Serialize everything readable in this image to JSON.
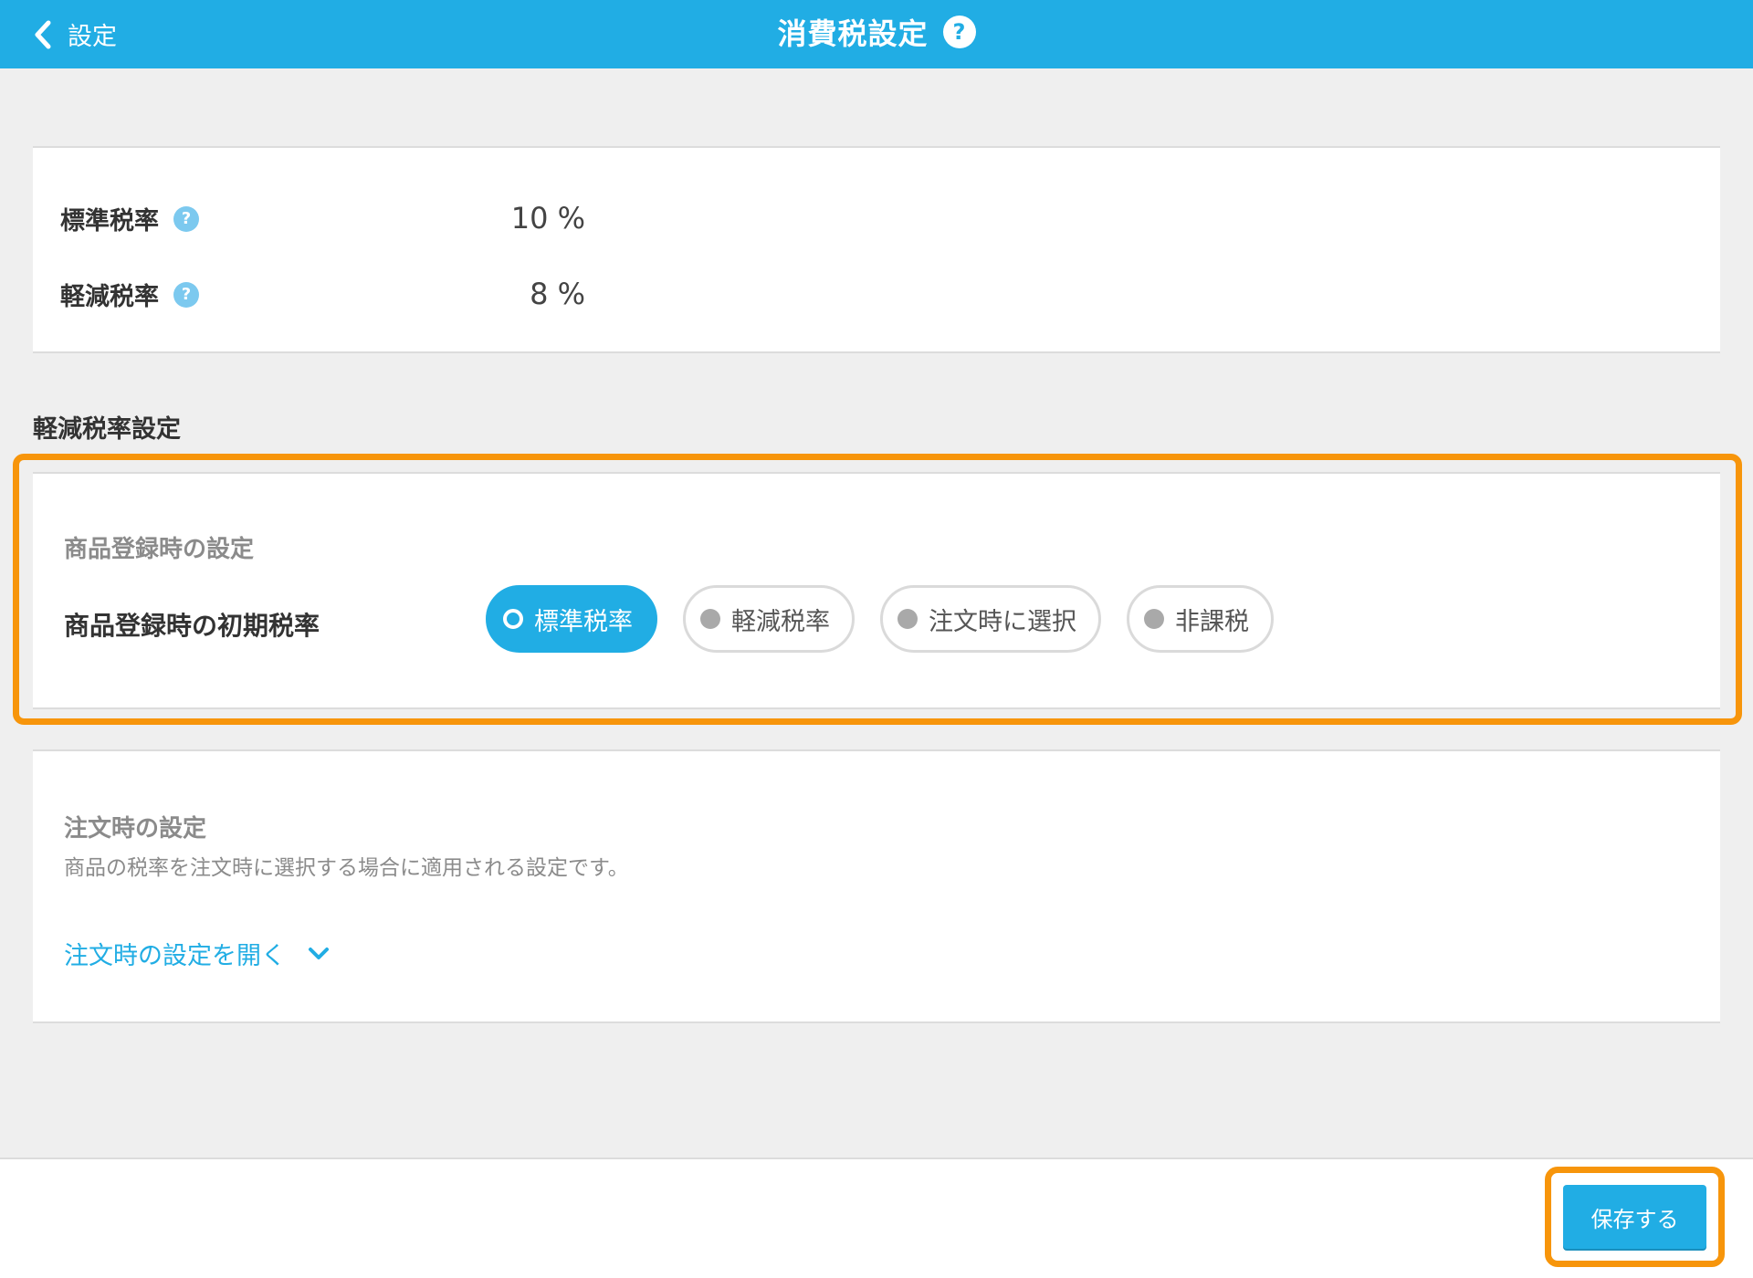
{
  "header": {
    "back_label": "設定",
    "title": "消費税設定",
    "help_glyph": "?"
  },
  "rates": [
    {
      "label": "標準税率",
      "help_glyph": "?",
      "value": "10 %"
    },
    {
      "label": "軽減税率",
      "help_glyph": "?",
      "value": "8 %"
    }
  ],
  "reduced_section": {
    "title": "軽減税率設定",
    "product_settings": {
      "heading": "商品登録時の設定",
      "field_label": "商品登録時の初期税率",
      "options": [
        {
          "label": "標準税率",
          "selected": true
        },
        {
          "label": "軽減税率",
          "selected": false
        },
        {
          "label": "注文時に選択",
          "selected": false
        },
        {
          "label": "非課税",
          "selected": false
        }
      ]
    },
    "order_settings": {
      "heading": "注文時の設定",
      "description": "商品の税率を注文時に選択する場合に適用される設定です。",
      "expand_label": "注文時の設定を開く"
    }
  },
  "footer": {
    "save_label": "保存する"
  },
  "colors": {
    "accent": "#21ade4",
    "highlight": "#f7950b",
    "background": "#efefef"
  }
}
